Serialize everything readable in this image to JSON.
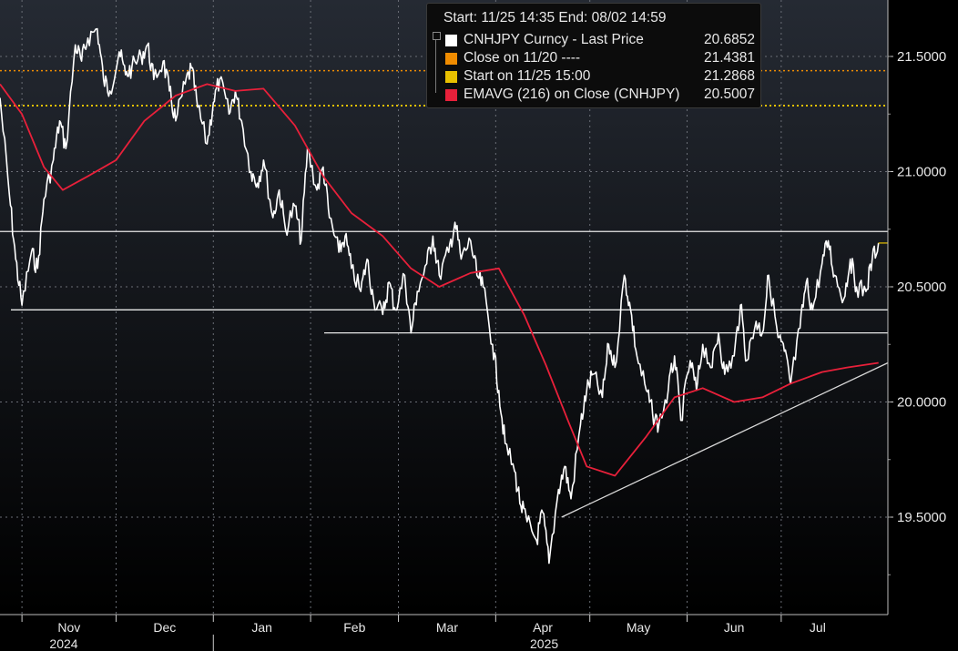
{
  "chart_data": {
    "type": "line",
    "title": "",
    "xlabel": "",
    "ylabel": "",
    "ylim": [
      19.18,
      21.68
    ],
    "x_range": [
      "2024-10-25",
      "2025-08-04"
    ],
    "grid": true,
    "legend_position": "top-center",
    "legend": {
      "header": "Start: 11/25 14:35 End: 08/02 14:59",
      "entries": [
        {
          "name": "CNHJPY Curncy - Last Price",
          "value": "20.6852",
          "color": "#ffffff"
        },
        {
          "name": "Close on 11/20 ----",
          "value": "21.4381",
          "color": "#f08c00"
        },
        {
          "name": "Start on 11/25 15:00",
          "value": "21.2868",
          "color": "#e8c000"
        },
        {
          "name": "EMAVG (216)  on Close (CNHJPY)",
          "value": "20.5007",
          "color": "#e8203a"
        }
      ]
    },
    "y_ticks": [
      "21.5000",
      "21.0000",
      "20.5000",
      "20.0000",
      "19.5000"
    ],
    "y_tick_values": [
      21.5,
      21.0,
      20.5,
      20.0,
      19.5
    ],
    "month_labels": [
      "Nov",
      "Dec",
      "Jan",
      "Feb",
      "Mar",
      "Apr",
      "May",
      "Jun",
      "Jul"
    ],
    "month_dates": [
      "2024-11-01",
      "2024-12-01",
      "2025-01-01",
      "2025-02-01",
      "2025-03-01",
      "2025-04-01",
      "2025-05-01",
      "2025-06-01",
      "2025-07-01"
    ],
    "year_labels": [
      "2024",
      "2025"
    ],
    "year_dates": [
      "2024-11-20",
      "2025-04-15"
    ],
    "series": [
      {
        "name": "CNHJPY Curncy - Last Price",
        "color": "#ffffff",
        "x": [
          "2024-10-25",
          "2024-10-28",
          "2024-10-30",
          "2024-11-01",
          "2024-11-04",
          "2024-11-06",
          "2024-11-08",
          "2024-11-11",
          "2024-11-13",
          "2024-11-15",
          "2024-11-18",
          "2024-11-20",
          "2024-11-22",
          "2024-11-25",
          "2024-11-27",
          "2024-11-29",
          "2024-12-02",
          "2024-12-04",
          "2024-12-06",
          "2024-12-09",
          "2024-12-11",
          "2024-12-13",
          "2024-12-16",
          "2024-12-18",
          "2024-12-20",
          "2024-12-23",
          "2024-12-25",
          "2024-12-27",
          "2024-12-30",
          "2025-01-01",
          "2025-01-03",
          "2025-01-06",
          "2025-01-08",
          "2025-01-10",
          "2025-01-13",
          "2025-01-15",
          "2025-01-17",
          "2025-01-20",
          "2025-01-22",
          "2025-01-24",
          "2025-01-27",
          "2025-01-29",
          "2025-01-31",
          "2025-02-03",
          "2025-02-05",
          "2025-02-07",
          "2025-02-10",
          "2025-02-12",
          "2025-02-14",
          "2025-02-17",
          "2025-02-19",
          "2025-02-21",
          "2025-02-24",
          "2025-02-26",
          "2025-02-28",
          "2025-03-03",
          "2025-03-05",
          "2025-03-07",
          "2025-03-10",
          "2025-03-12",
          "2025-03-14",
          "2025-03-17",
          "2025-03-19",
          "2025-03-21",
          "2025-03-24",
          "2025-03-26",
          "2025-03-28",
          "2025-03-31",
          "2025-04-02",
          "2025-04-04",
          "2025-04-07",
          "2025-04-09",
          "2025-04-11",
          "2025-04-14",
          "2025-04-16",
          "2025-04-18",
          "2025-04-21",
          "2025-04-23",
          "2025-04-25",
          "2025-04-28",
          "2025-04-30",
          "2025-05-02",
          "2025-05-05",
          "2025-05-07",
          "2025-05-09",
          "2025-05-12",
          "2025-05-14",
          "2025-05-16",
          "2025-05-19",
          "2025-05-21",
          "2025-05-23",
          "2025-05-26",
          "2025-05-28",
          "2025-05-30",
          "2025-06-02",
          "2025-06-04",
          "2025-06-06",
          "2025-06-09",
          "2025-06-11",
          "2025-06-13",
          "2025-06-16",
          "2025-06-18",
          "2025-06-20",
          "2025-06-23",
          "2025-06-25",
          "2025-06-27",
          "2025-06-30",
          "2025-07-02",
          "2025-07-04",
          "2025-07-07",
          "2025-07-09",
          "2025-07-11",
          "2025-07-14",
          "2025-07-16",
          "2025-07-18",
          "2025-07-21",
          "2025-07-23",
          "2025-07-25",
          "2025-07-28",
          "2025-07-30",
          "2025-08-01"
        ],
        "values": [
          21.32,
          20.9,
          20.62,
          20.42,
          20.65,
          20.58,
          20.88,
          21.05,
          21.22,
          21.1,
          21.55,
          21.48,
          21.58,
          21.62,
          21.4,
          21.35,
          21.52,
          21.42,
          21.45,
          21.5,
          21.55,
          21.4,
          21.48,
          21.35,
          21.22,
          21.38,
          21.45,
          21.28,
          21.12,
          21.3,
          21.4,
          21.25,
          21.35,
          21.22,
          21.0,
          20.95,
          21.05,
          20.8,
          20.92,
          20.75,
          20.85,
          20.7,
          21.1,
          20.92,
          21.02,
          20.8,
          20.65,
          20.72,
          20.58,
          20.48,
          20.62,
          20.45,
          20.38,
          20.52,
          20.4,
          20.55,
          20.3,
          20.48,
          20.6,
          20.72,
          20.55,
          20.65,
          20.78,
          20.62,
          20.7,
          20.55,
          20.5,
          20.25,
          20.05,
          19.82,
          19.7,
          19.55,
          19.48,
          19.4,
          19.52,
          19.3,
          19.62,
          19.72,
          19.58,
          19.9,
          20.05,
          20.12,
          20.02,
          20.25,
          20.15,
          20.55,
          20.4,
          20.2,
          20.05,
          19.95,
          19.9,
          20.05,
          20.2,
          19.92,
          20.18,
          20.05,
          20.25,
          20.15,
          20.3,
          20.12,
          20.2,
          20.42,
          20.18,
          20.35,
          20.3,
          20.55,
          20.28,
          20.22,
          20.08,
          20.32,
          20.52,
          20.4,
          20.6,
          20.7,
          20.55,
          20.45,
          20.62,
          20.5,
          20.48,
          20.62,
          20.69
        ]
      },
      {
        "name": "EMAVG (216)  on Close (CNHJPY)",
        "color": "#e8203a",
        "x": [
          "2024-10-25",
          "2024-11-01",
          "2024-11-08",
          "2024-11-14",
          "2024-11-22",
          "2024-12-01",
          "2024-12-10",
          "2024-12-20",
          "2024-12-30",
          "2025-01-08",
          "2025-01-17",
          "2025-01-27",
          "2025-02-05",
          "2025-02-14",
          "2025-02-24",
          "2025-03-05",
          "2025-03-14",
          "2025-03-24",
          "2025-04-02",
          "2025-04-10",
          "2025-04-17",
          "2025-04-24",
          "2025-04-30",
          "2025-05-09",
          "2025-05-19",
          "2025-05-28",
          "2025-06-06",
          "2025-06-16",
          "2025-06-25",
          "2025-07-04",
          "2025-07-14",
          "2025-07-22",
          "2025-08-01"
        ],
        "values": [
          21.38,
          21.25,
          21.02,
          20.92,
          20.98,
          21.05,
          21.22,
          21.33,
          21.38,
          21.35,
          21.36,
          21.2,
          20.98,
          20.82,
          20.72,
          20.58,
          20.5,
          20.56,
          20.58,
          20.38,
          20.16,
          19.92,
          19.72,
          19.68,
          19.85,
          20.02,
          20.06,
          20.0,
          20.02,
          20.08,
          20.13,
          20.15,
          20.17
        ]
      }
    ]
  },
  "reference_lines": {
    "close_on_1120": {
      "value": 21.4381,
      "color": "#f08c00",
      "style": "dotted"
    },
    "start_on_1125": {
      "value": 21.2868,
      "color": "#e8c000",
      "style": "dotted"
    },
    "horizontal_levels": [
      20.74,
      20.4,
      20.3
    ],
    "trendline": {
      "from": [
        "2025-04-22",
        19.5
      ],
      "to": [
        "2025-08-04",
        20.17
      ]
    }
  }
}
